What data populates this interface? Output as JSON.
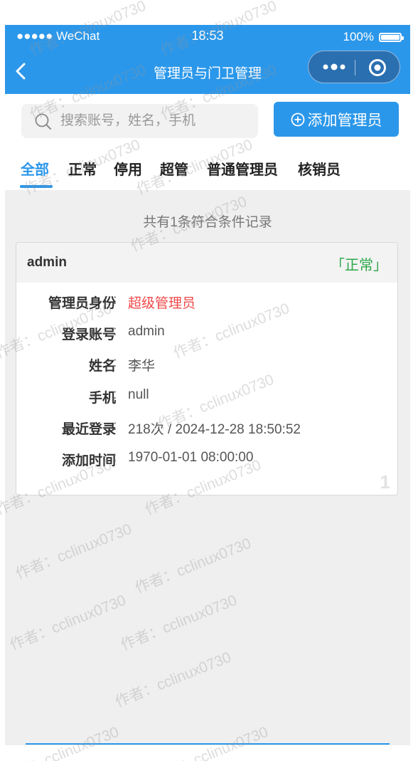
{
  "status_bar": {
    "carrier": "●●●●● WeChat",
    "time": "18:53",
    "battery": "100%"
  },
  "nav": {
    "title": "管理员与门卫管理"
  },
  "search": {
    "placeholder": "搜索账号，姓名，手机",
    "value": ""
  },
  "add_button": {
    "label": "添加管理员"
  },
  "tabs": [
    {
      "label": "全部",
      "active": true
    },
    {
      "label": "正常"
    },
    {
      "label": "停用"
    },
    {
      "label": "超管"
    },
    {
      "label": "普通管理员"
    },
    {
      "label": "核销员"
    }
  ],
  "summary": "共有1条符合条件记录",
  "record": {
    "name": "admin",
    "status": "「正常」",
    "index": "1",
    "fields": [
      {
        "label": "管理员身份",
        "colon": ":",
        "value": "超级管理员"
      },
      {
        "label": "登录账号",
        "colon": ":",
        "value": "admin"
      },
      {
        "label": "姓名",
        "colon": ":",
        "value": "李华"
      },
      {
        "label": "手机",
        "colon": ":",
        "value": "null"
      },
      {
        "label": "最近登录",
        "colon": ":",
        "value": "218次 / 2024-12-28 18:50:52"
      },
      {
        "label": "添加时间",
        "colon": ":",
        "value": "1970-01-01 08:00:00"
      }
    ]
  },
  "watermark": "作者：cclinux0730",
  "colors": {
    "primary": "#2b97ea",
    "status_ok": "#2fa84a",
    "role_red": "#f04848",
    "page_bg": "#efefef"
  },
  "icons": [
    "back-arrow-icon",
    "more-dots-icon",
    "target-icon",
    "search-icon",
    "plus-circle-icon",
    "battery-icon"
  ]
}
